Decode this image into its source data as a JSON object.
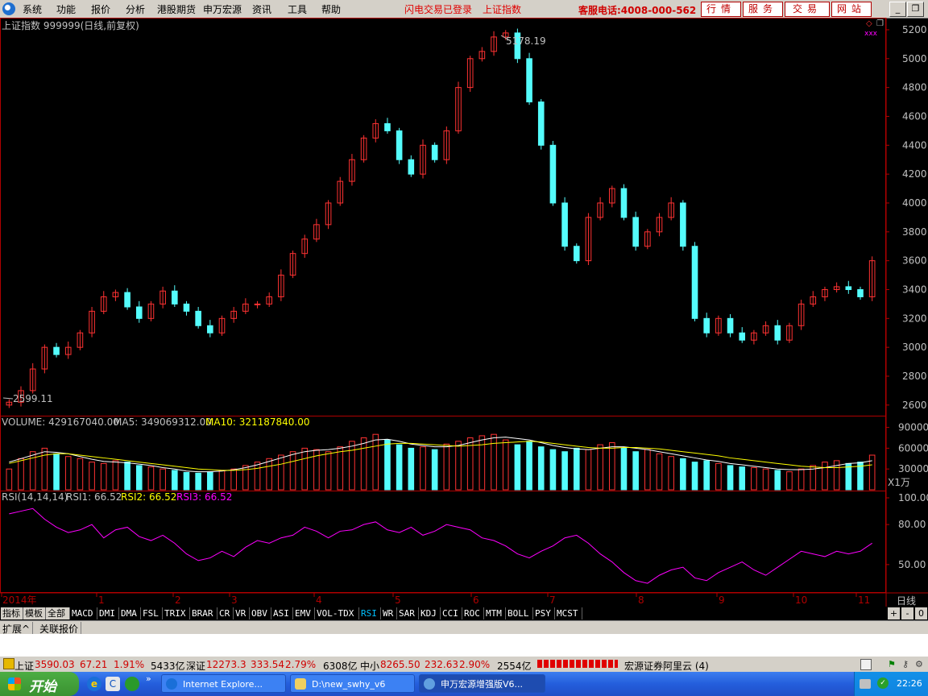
{
  "menu": {
    "items": [
      "系统",
      "功能",
      "报价",
      "分析",
      "港股期货",
      "申万宏源",
      "资讯",
      "工具",
      "帮助"
    ],
    "flash_status": "闪电交易已登录",
    "current_index": "上证指数",
    "service_hotline": "客服电话:4008-000-562",
    "buttons": [
      "行情",
      "服务",
      "交易",
      "网站"
    ]
  },
  "chart_header": {
    "title": "上证指数 999999(日线,前复权)",
    "high_label": "5178.19",
    "low_label": "2599.11"
  },
  "volume": {
    "label": "VOLUME: 429167040.00",
    "ma5": "MA5: 349069312.00",
    "ma10": "MA10: 321187840.00",
    "unit": "X1万",
    "ticks": [
      "90000",
      "60000",
      "30000"
    ]
  },
  "rsi": {
    "label": "RSI(14,14,14)",
    "rsi1": "RSI1: 66.52",
    "rsi2": "RSI2: 66.52",
    "rsi3": "RSI3: 66.52",
    "ticks": [
      "100.00",
      "80.00",
      "50.00"
    ]
  },
  "chart_data": {
    "type": "candlestick",
    "price_ticks": [
      5200,
      5000,
      4800,
      4600,
      4400,
      4200,
      4000,
      3800,
      3600,
      3400,
      3200,
      3000,
      2800,
      2600
    ],
    "price_range": [
      2560,
      5250
    ],
    "x_labels": [
      "2014年",
      "1",
      "2",
      "3",
      "4",
      "5",
      "6",
      "7",
      "8",
      "9",
      "10",
      "11"
    ],
    "period_label": "日线",
    "close_series": [
      2620,
      2700,
      2850,
      3000,
      2950,
      3000,
      3100,
      3250,
      3350,
      3380,
      3280,
      3200,
      3300,
      3390,
      3300,
      3250,
      3150,
      3100,
      3200,
      3250,
      3300,
      3300,
      3350,
      3500,
      3650,
      3750,
      3850,
      4000,
      4150,
      4300,
      4450,
      4550,
      4500,
      4300,
      4200,
      4400,
      4300,
      4500,
      4800,
      5000,
      5050,
      5150,
      5178,
      5000,
      4700,
      4400,
      4000,
      3700,
      3600,
      3900,
      4000,
      4100,
      3900,
      3700,
      3800,
      3900,
      4000,
      3700,
      3200,
      3100,
      3200,
      3100,
      3050,
      3100,
      3150,
      3050,
      3150,
      3300,
      3350,
      3400,
      3420,
      3400,
      3350,
      3600
    ],
    "rsi_series": [
      88,
      90,
      92,
      84,
      78,
      74,
      76,
      80,
      70,
      76,
      78,
      71,
      68,
      72,
      66,
      58,
      53,
      55,
      60,
      56,
      63,
      68,
      66,
      70,
      72,
      78,
      75,
      70,
      75,
      76,
      80,
      82,
      76,
      74,
      78,
      72,
      75,
      80,
      78,
      76,
      70,
      68,
      64,
      58,
      55,
      60,
      64,
      70,
      72,
      66,
      58,
      52,
      44,
      38,
      36,
      42,
      46,
      48,
      40,
      38,
      44,
      48,
      52,
      46,
      42,
      48,
      54,
      60,
      58,
      56,
      60,
      58,
      60,
      66
    ],
    "volume_series": [
      30,
      45,
      55,
      60,
      52,
      48,
      45,
      40,
      38,
      42,
      40,
      35,
      33,
      30,
      28,
      25,
      24,
      26,
      28,
      30,
      35,
      40,
      45,
      50,
      55,
      60,
      58,
      55,
      62,
      70,
      75,
      80,
      72,
      65,
      60,
      62,
      58,
      66,
      70,
      75,
      78,
      80,
      72,
      65,
      70,
      62,
      58,
      55,
      60,
      58,
      65,
      68,
      60,
      55,
      58,
      52,
      48,
      45,
      40,
      42,
      38,
      35,
      33,
      32,
      30,
      28,
      26,
      30,
      35,
      40,
      42,
      38,
      40,
      50
    ],
    "ma5": [
      40,
      45,
      50,
      55,
      54,
      52,
      48,
      44,
      41,
      40,
      39,
      37,
      35,
      32,
      30,
      27,
      26,
      26,
      27,
      29,
      32,
      36,
      41,
      46,
      51,
      55,
      57,
      58,
      60,
      63,
      67,
      72,
      73,
      70,
      66,
      64,
      62,
      62,
      64,
      68,
      72,
      75,
      76,
      74,
      72,
      68,
      64,
      61,
      59,
      58,
      60,
      62,
      62,
      60,
      58,
      55,
      52,
      49,
      46,
      43,
      41,
      38,
      36,
      34,
      32,
      30,
      29,
      29,
      30,
      32,
      35,
      38,
      39,
      42
    ],
    "ma10": [
      38,
      42,
      46,
      50,
      52,
      52,
      50,
      48,
      46,
      44,
      42,
      40,
      38,
      36,
      34,
      32,
      30,
      29,
      28,
      28,
      29,
      31,
      34,
      37,
      41,
      45,
      49,
      52,
      55,
      57,
      60,
      63,
      66,
      67,
      67,
      66,
      65,
      64,
      63,
      64,
      65,
      67,
      68,
      69,
      70,
      69,
      67,
      65,
      63,
      61,
      60,
      60,
      61,
      61,
      60,
      59,
      57,
      55,
      53,
      51,
      49,
      46,
      44,
      42,
      40,
      38,
      36,
      34,
      33,
      32,
      32,
      33,
      34,
      36
    ]
  },
  "tabs": [
    "指标",
    "模板",
    "全部",
    "MACD",
    "DMI",
    "DMA",
    "FSL",
    "TRIX",
    "BRAR",
    "CR",
    "VR",
    "OBV",
    "ASI",
    "EMV",
    "VOL-TDX",
    "RSI",
    "WR",
    "SAR",
    "KDJ",
    "CCI",
    "ROC",
    "MTM",
    "BOLL",
    "PSY",
    "MCST"
  ],
  "tab_controls": [
    "+",
    "-",
    "0"
  ],
  "extension_tabs": [
    "扩展^",
    "关联报价"
  ],
  "status": {
    "sh_name": "上证",
    "sh_value": "3590.03",
    "sh_change": "67.21",
    "sh_pct": "1.91%",
    "sh_amount": "5433亿",
    "sz_name": "深证",
    "sz_value": "12273.3",
    "sz_change": "333.54",
    "sz_pct": "2.79%",
    "sz_amount": "6308亿",
    "zx_name": "中小",
    "zx_value": "8265.50",
    "zx_change": "232.63",
    "zx_pct": "2.90%",
    "zx_amount": "2554亿",
    "server": "宏源证券阿里云 (4)"
  },
  "taskbar": {
    "start": "开始",
    "tasks": [
      "Internet Explore...",
      "D:\\new_swhy_v6",
      "申万宏源增强版V6..."
    ],
    "time": "22:26"
  },
  "colors": {
    "up": "#ff3232",
    "down": "#54fcfc",
    "grid": "#800000",
    "ma5": "#ffffff",
    "ma10": "#ffff00",
    "rsi": "#ff00ff"
  }
}
